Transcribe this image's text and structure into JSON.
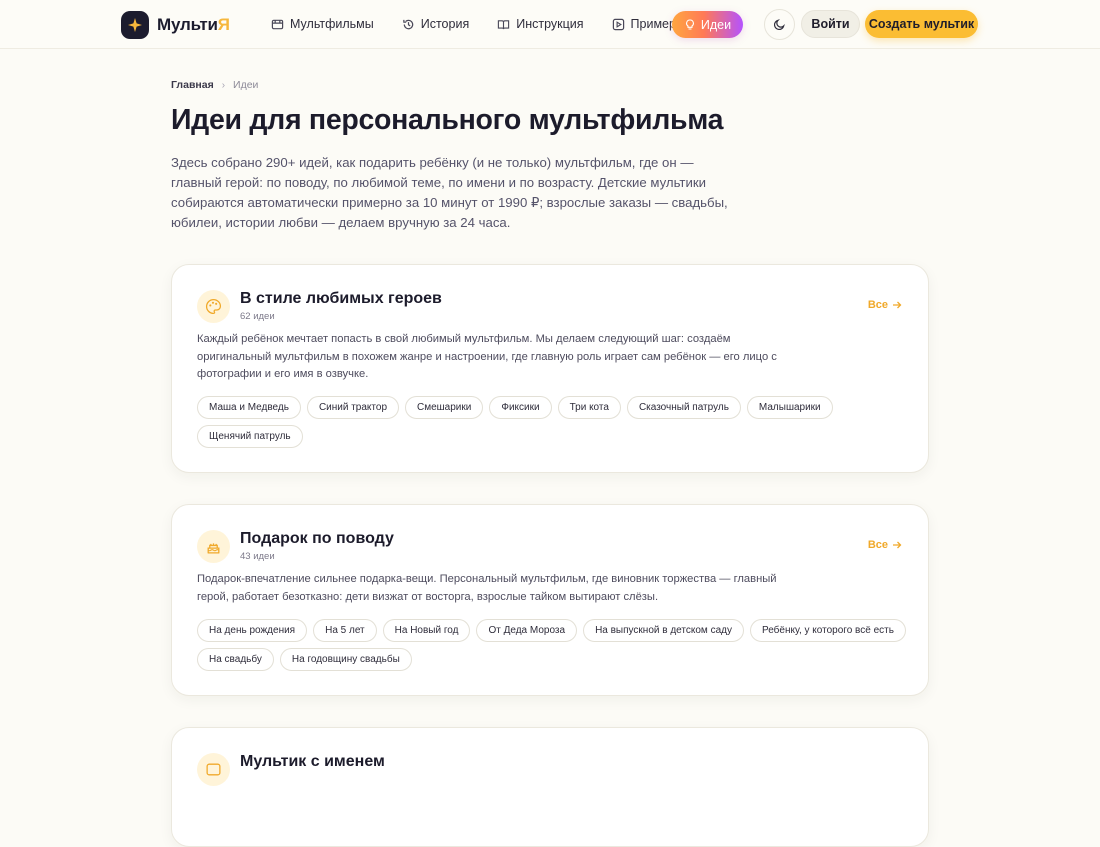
{
  "header": {
    "logo_text_main": "Мульти",
    "logo_text_accent": "Я",
    "nav": [
      {
        "label": "Мультфильмы",
        "icon": "film-icon"
      },
      {
        "label": "История",
        "icon": "history-icon"
      },
      {
        "label": "Инструкция",
        "icon": "book-icon"
      },
      {
        "label": "Примеры",
        "icon": "play-icon"
      }
    ],
    "active_nav": {
      "label": "Идеи",
      "icon": "lightbulb-icon"
    },
    "login_label": "Войти",
    "create_label": "Создать мультик"
  },
  "breadcrumb": {
    "home": "Главная",
    "separator": "›",
    "current": "Идеи"
  },
  "page": {
    "title": "Идеи для персонального мультфильма",
    "intro": "Здесь собрано 290+ идей, как подарить ребёнку (и не только) мультфильм, где он — главный герой: по поводу, по любимой теме, по имени и по возрасту. Детские мультики собираются автоматически примерно за 10 минут от 1990 ₽; взрослые заказы — свадьбы, юбилеи, истории любви — делаем вручную за 24 часа."
  },
  "cards": [
    {
      "icon": "palette-icon",
      "title": "В стиле любимых героев",
      "count": "62 идеи",
      "all_label": "Все",
      "description": "Каждый ребёнок мечтает попасть в свой любимый мультфильм. Мы делаем следующий шаг: создаём оригинальный мультфильм в похожем жанре и настроении, где главную роль играет сам ребёнок — его лицо с фотографии и его имя в озвучке.",
      "tags": [
        "Маша и Медведь",
        "Синий трактор",
        "Смешарики",
        "Фиксики",
        "Три кота",
        "Сказочный патруль",
        "Малышарики",
        "Щенячий патруль"
      ]
    },
    {
      "icon": "cake-icon",
      "title": "Подарок по поводу",
      "count": "43 идеи",
      "all_label": "Все",
      "description": "Подарок-впечатление сильнее подарка-вещи. Персональный мультфильм, где виновник торжества — главный герой, работает безотказно: дети визжат от восторга, взрослые тайком вытирают слёзы.",
      "tags": [
        "На день рождения",
        "На 5 лет",
        "На Новый год",
        "От Деда Мороза",
        "На выпускной в детском саду",
        "Ребёнку, у которого всё есть",
        "На свадьбу",
        "На годовщину свадьбы"
      ]
    },
    {
      "icon": "name-icon",
      "title": "Мультик с именем",
      "count": "",
      "all_label": "",
      "description": "",
      "tags": []
    }
  ]
}
